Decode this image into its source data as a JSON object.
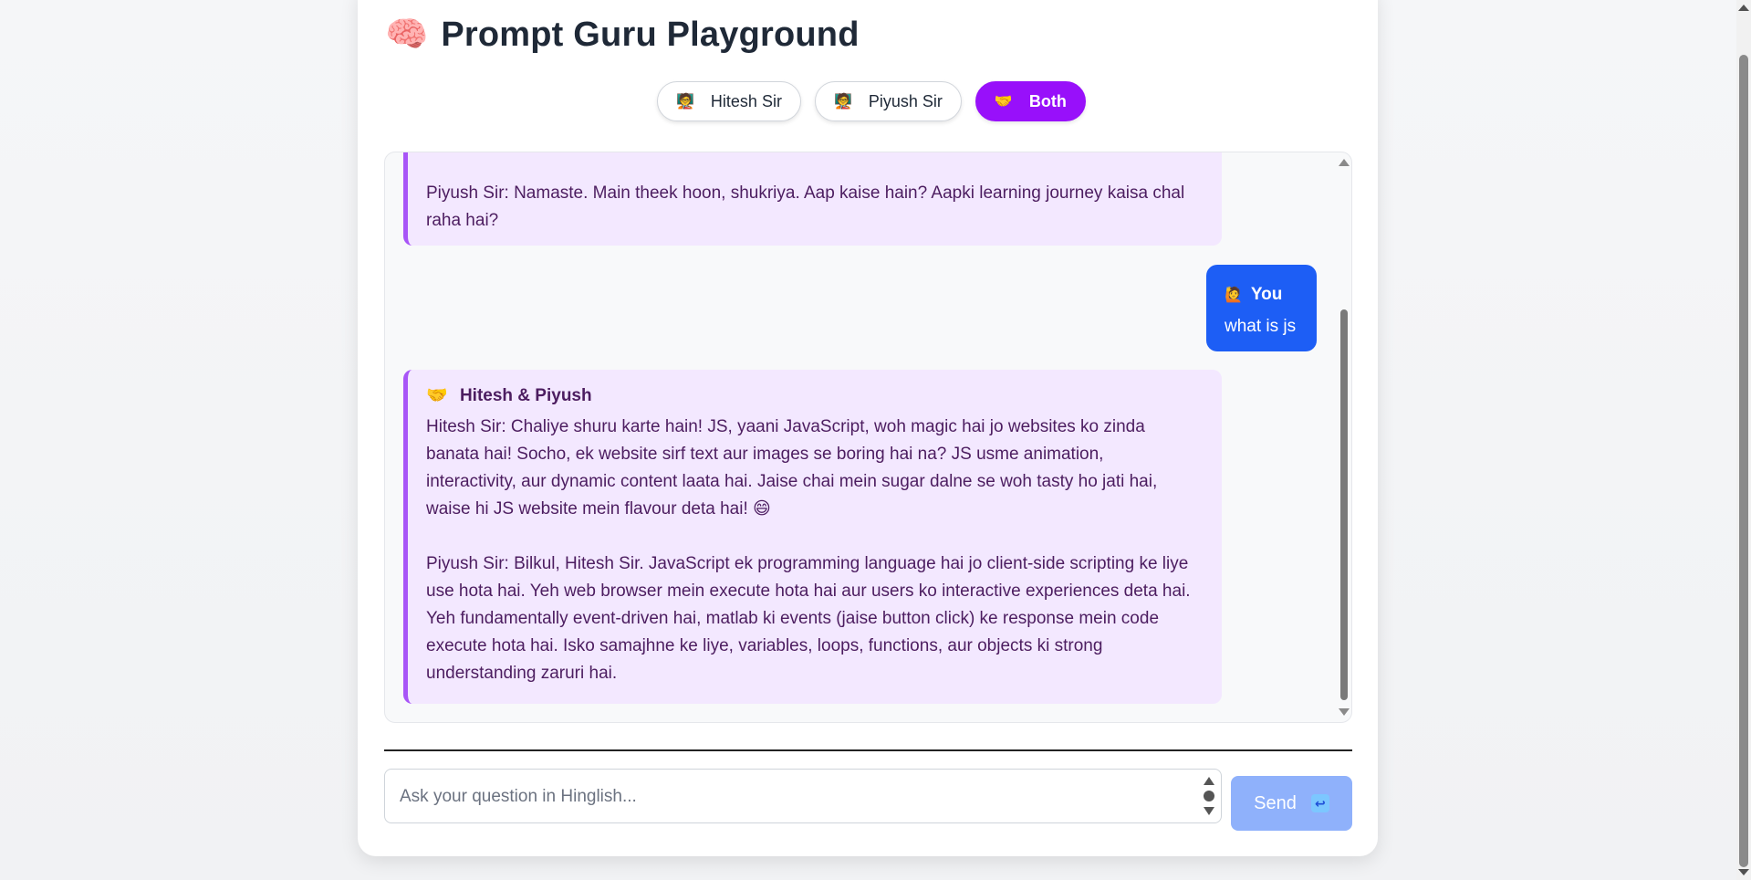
{
  "app": {
    "title_emoji": "🧠",
    "title": "Prompt Guru Playground"
  },
  "modes": [
    {
      "emoji": "🧑‍🏫",
      "label": "Hitesh Sir",
      "active": false
    },
    {
      "emoji": "🧑‍🏫",
      "label": "Piyush Sir",
      "active": false
    },
    {
      "emoji": "🤝",
      "label": "Both",
      "active": true
    }
  ],
  "chat": {
    "messages": [
      {
        "role": "bot",
        "paragraphs": [
          "Piyush Sir: Namaste.  Main theek hoon, shukriya.  Aap kaise hain?  Aapki learning journey kaisa chal raha hai?"
        ]
      },
      {
        "role": "user",
        "sender_emoji": "🙋",
        "sender": "You",
        "text": "what is js"
      },
      {
        "role": "bot",
        "sender_emoji": "🤝",
        "sender": "Hitesh & Piyush",
        "paragraphs": [
          "Hitesh Sir: Chaliye shuru karte hain!  JS, yaani JavaScript, woh magic hai jo websites ko zinda banata hai!  Socho, ek website sirf text aur images se boring hai na?  JS usme animation, interactivity, aur dynamic content laata hai.  Jaise chai mein sugar dalne se woh tasty ho jati hai, waise hi JS website mein flavour deta hai! 😄",
          "Piyush Sir: Bilkul, Hitesh Sir. JavaScript ek programming language hai jo client-side scripting ke liye use hota hai. Yeh web browser mein execute hota hai aur users ko interactive experiences deta hai.  Yeh fundamentally event-driven hai, matlab ki events (jaise button click) ke response mein code execute hota hai.  Isko samajhne ke liye, variables, loops, functions, aur objects ki strong understanding zaruri hai."
        ]
      }
    ]
  },
  "composer": {
    "placeholder": "Ask your question in Hinglish...",
    "value": "",
    "send_label": "Send",
    "send_icon": "↩"
  },
  "colors": {
    "accent_purple": "#9810fa",
    "user_bubble": "#1d5ef5",
    "bot_bubble": "#f3e8ff",
    "send_disabled": "#8fb1fb"
  }
}
